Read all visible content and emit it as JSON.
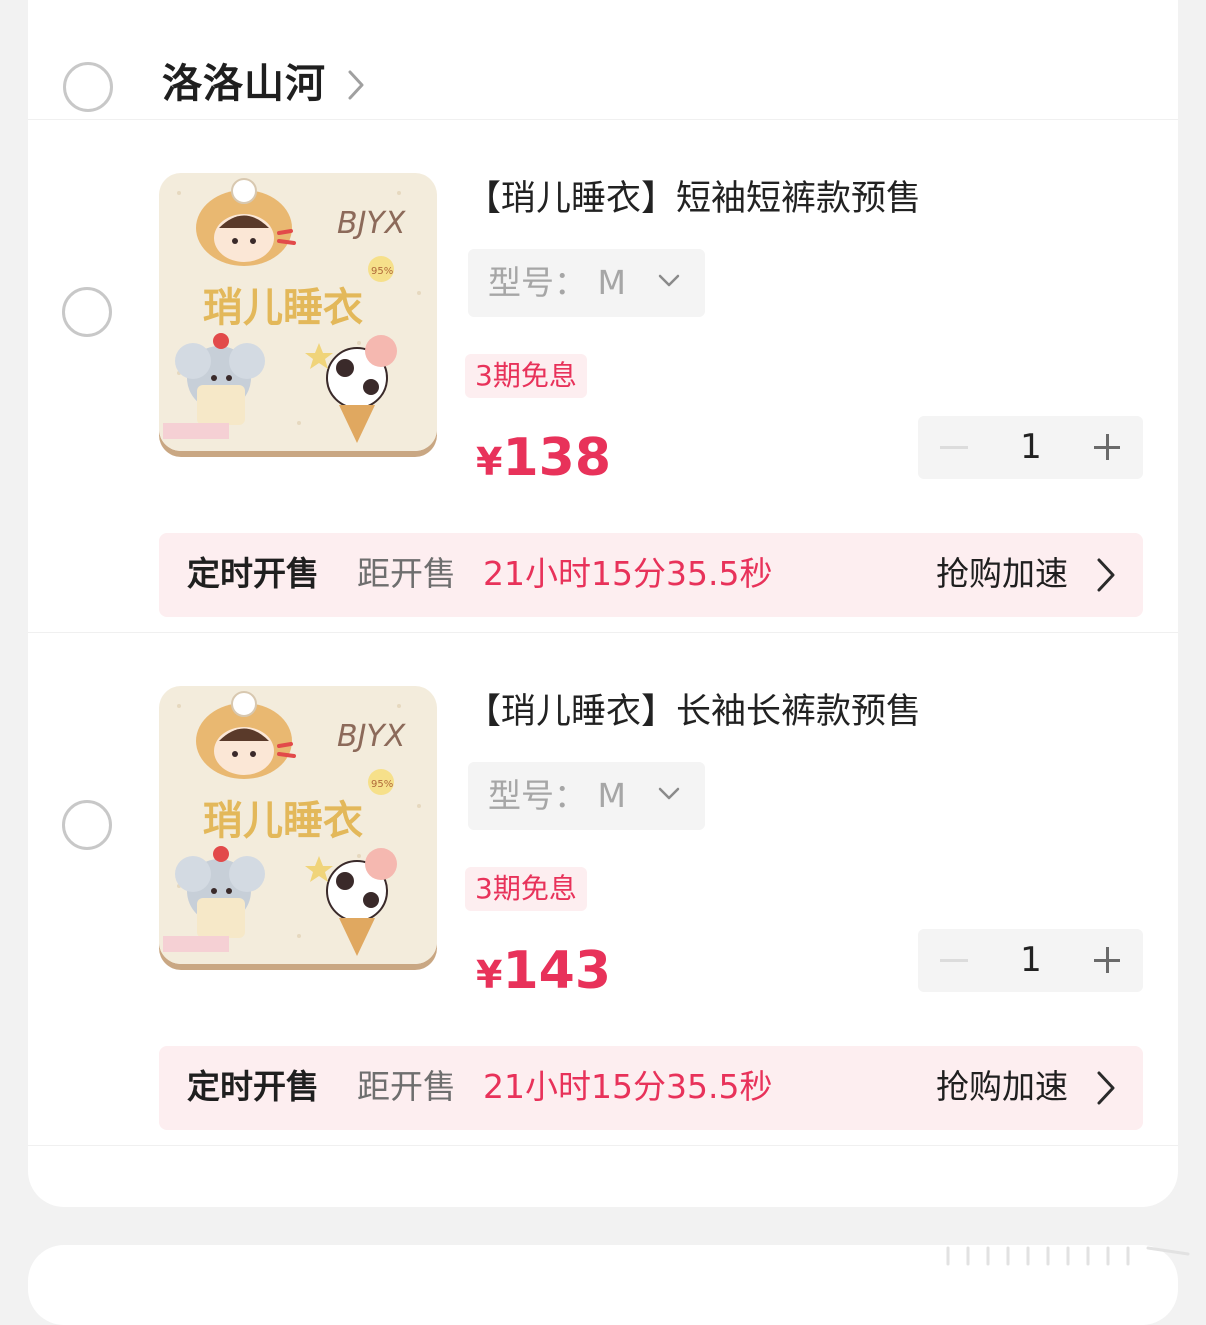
{
  "store": {
    "name": "洛洛山河"
  },
  "items": [
    {
      "title": "【琑儿睡衣】短袖短裤款预售",
      "spec_label": "型号：",
      "spec_value": "M",
      "badge": "3期免息",
      "currency": "¥",
      "price": "138",
      "quantity": "1",
      "thumb": {
        "brand": "BJYX",
        "caption": "琑儿睡衣",
        "percent": "95%"
      },
      "timer": {
        "label": "定时开售",
        "prefix": "距开售",
        "countdown": "21小时15分35.5秒",
        "action": "抢购加速"
      }
    },
    {
      "title": "【琑儿睡衣】长袖长裤款预售",
      "spec_label": "型号：",
      "spec_value": "M",
      "badge": "3期免息",
      "currency": "¥",
      "price": "143",
      "quantity": "1",
      "thumb": {
        "brand": "BJYX",
        "caption": "琑儿睡衣",
        "percent": "95%"
      },
      "timer": {
        "label": "定时开售",
        "prefix": "距开售",
        "countdown": "21小时15分35.5秒",
        "action": "抢购加速"
      }
    }
  ],
  "colors": {
    "accent": "#e8325a",
    "badge_bg": "#fdeef0",
    "card_bg": "#ffffff",
    "page_bg": "#f2f2f2"
  }
}
